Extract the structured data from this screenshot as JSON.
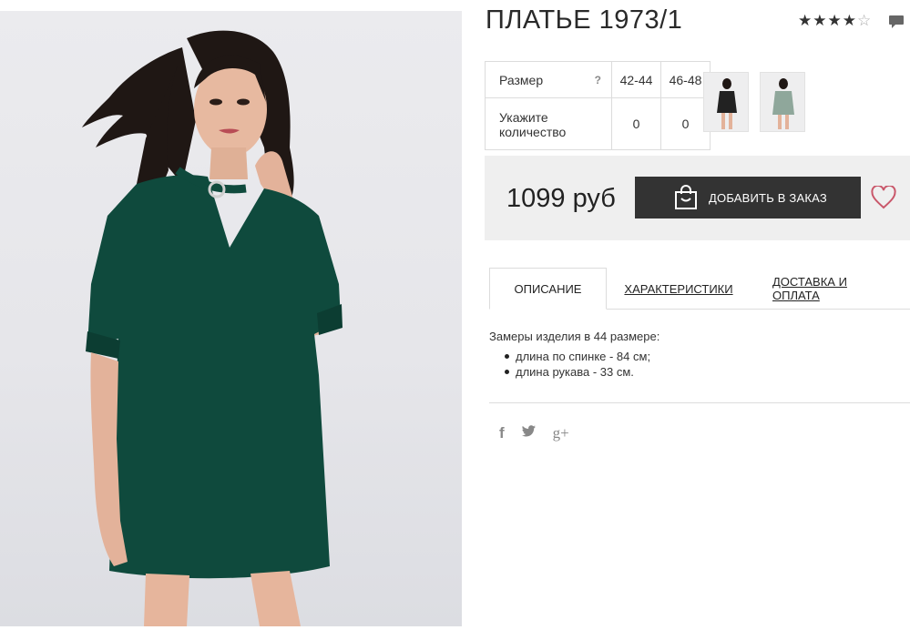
{
  "product": {
    "title": "ПЛАТЬЕ 1973/1",
    "rating": 4,
    "rating_max": 5,
    "dress_color": "#0f4a3d"
  },
  "size_table": {
    "size_label": "Размер",
    "help_label": "?",
    "sizes": [
      "42-44",
      "46-48"
    ],
    "qty_label": "Укажите количество",
    "quantities": [
      "0",
      "0"
    ]
  },
  "price": {
    "amount": "1099 руб",
    "add_label": "ДОБАВИТЬ В ЗАКАЗ"
  },
  "tabs": [
    {
      "label": "ОПИСАНИЕ",
      "active": true
    },
    {
      "label": "ХАРАКТЕРИСТИКИ",
      "active": false
    },
    {
      "label": "ДОСТАВКА И ОПЛАТА",
      "active": false
    }
  ],
  "description": {
    "intro": "Замеры изделия в 44 размере:",
    "items": [
      "длина по спинке - 84 см;",
      "длина рукава - 33 см."
    ]
  },
  "social": {
    "facebook": "f",
    "twitter": "twitter-icon",
    "google_plus": "g+"
  },
  "colors": {
    "accent_heart": "#c9576a",
    "button_bg": "#333333",
    "price_bg": "#efefef"
  }
}
